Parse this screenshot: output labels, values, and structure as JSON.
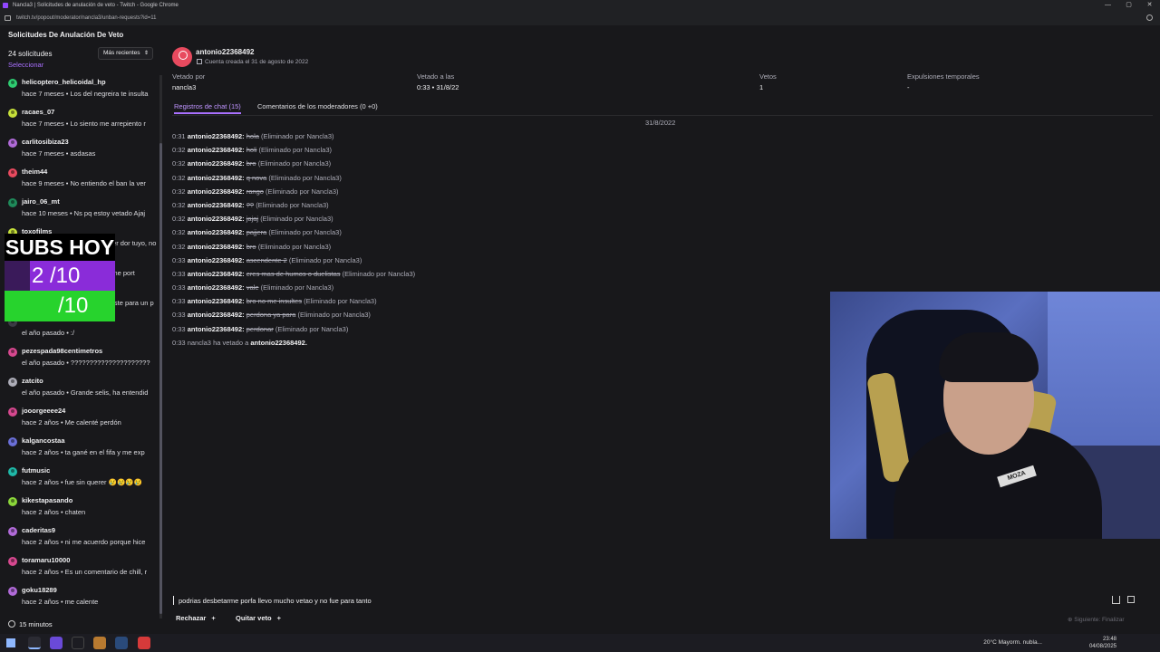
{
  "window": {
    "title": "Nancla3 | Solicitudes de anulación de veto - Twitch - Google Chrome",
    "url": "twitch.tv/popout/moderator/nancla3/unban-requests?id=11"
  },
  "sidebar": {
    "title": "Solicitudes De Anulación De Veto",
    "count": "24 solicitudes",
    "select_label": "Seleccionar",
    "sort_label": "Más recientes",
    "footer": "15 minutos",
    "items": [
      {
        "name": "helicoptero_helicoidal_hp",
        "meta": "hace 7 meses • Los del negreira te insulta",
        "color": "#2ecc71"
      },
      {
        "name": "racaes_07",
        "meta": "hace 7 meses • Lo siento me arrepiento r",
        "color": "#c6e03a"
      },
      {
        "name": "carlitosibiza23",
        "meta": "hace 7 meses • asdasas",
        "color": "#b06ad8"
      },
      {
        "name": "theim44",
        "meta": "hace 9 meses • No entiendo el ban la ver",
        "color": "#e84a5f"
      },
      {
        "name": "jairo_06_mt",
        "meta": "hace 10 meses • Ns pq estoy vetado Ajaj",
        "color": "#1f8a5a"
      },
      {
        "name": "toxofilms",
        "meta": "hace 11 meses • Perdón por ser dor tuyo, no",
        "color": "#c6e03a"
      },
      {
        "name": "",
        "meta": "el año pasado • Perdón, betarme port",
        "color": "#3b3b44"
      },
      {
        "name": "",
        "meta": "el año pasado • que me baneaste para un p",
        "color": "#3b3b44"
      },
      {
        "name": "",
        "meta": "el año pasado • :/",
        "color": "#3b3b44"
      },
      {
        "name": "pezespada98centimetros",
        "meta": "el año pasado • ?????????????????????",
        "color": "#d6488f"
      },
      {
        "name": "zatcito",
        "meta": "el año pasado • Grande selis, ha entendid",
        "color": "#adadb8"
      },
      {
        "name": "jooorgeeee24",
        "meta": "hace 2 años • Me calenté perdón",
        "color": "#d6488f"
      },
      {
        "name": "kalgancostaa",
        "meta": "hace 2 años • ta gané en el fifa y me exp",
        "color": "#6a6fd8"
      },
      {
        "name": "futmusic",
        "meta": "hace 2 años • fue sin querer 😢😢😢😢",
        "color": "#1fb8a8"
      },
      {
        "name": "kikestapasando",
        "meta": "hace 2 años • chaten",
        "color": "#8bd63a"
      },
      {
        "name": "caderitas9",
        "meta": "hace 2 años • ni me acuerdo porque hice",
        "color": "#b06ad8"
      },
      {
        "name": "toramaru10000",
        "meta": "hace 2 años • Es un comentario de chill, r",
        "color": "#d6488f"
      },
      {
        "name": "goku18289",
        "meta": "hace 2 años • me calente",
        "color": "#b06ad8"
      }
    ]
  },
  "overlay": {
    "title": "SUBS HOY",
    "row1": "2 /10",
    "row2": "/10"
  },
  "profile": {
    "username": "antonio22368492",
    "created": "Cuenta creada el 31 de agosto de 2022",
    "avatar_color": "#e84a5f"
  },
  "stats": {
    "banned_by_label": "Vetado por",
    "banned_by": "nancla3",
    "banned_at_label": "Vetado a las",
    "banned_at": "0:33 • 31/8/22",
    "bans_label": "Vetos",
    "bans": "1",
    "timeouts_label": "Expulsiones temporales",
    "timeouts": "-"
  },
  "tabs": {
    "chat_logs": "Registros de chat (15)",
    "mod_comments": "Comentarios de los moderadores (0 +0)"
  },
  "chat": {
    "date": "31/8/2022",
    "deleted_by": "(Eliminado por Nancla3)",
    "lines": [
      {
        "time": "0:31",
        "user": "antonio22368492:",
        "msg": "hola"
      },
      {
        "time": "0:32",
        "user": "antonio22368492:",
        "msg": "holi"
      },
      {
        "time": "0:32",
        "user": "antonio22368492:",
        "msg": "bro"
      },
      {
        "time": "0:32",
        "user": "antonio22368492:",
        "msg": "q nova"
      },
      {
        "time": "0:32",
        "user": "antonio22368492:",
        "msg": "rango"
      },
      {
        "time": "0:32",
        "user": "antonio22368492:",
        "msg": "??"
      },
      {
        "time": "0:32",
        "user": "antonio22368492:",
        "msg": "jajaj"
      },
      {
        "time": "0:32",
        "user": "antonio22368492:",
        "msg": "pajjera"
      },
      {
        "time": "0:32",
        "user": "antonio22368492:",
        "msg": "bro"
      },
      {
        "time": "0:33",
        "user": "antonio22368492:",
        "msg": "ascendente 2"
      },
      {
        "time": "0:33",
        "user": "antonio22368492:",
        "msg": "eres mas de humos o duelistas"
      },
      {
        "time": "0:33",
        "user": "antonio22368492:",
        "msg": "vale"
      },
      {
        "time": "0:33",
        "user": "antonio22368492:",
        "msg": "bro no me insultes"
      },
      {
        "time": "0:33",
        "user": "antonio22368492:",
        "msg": "perdona ya para"
      },
      {
        "time": "0:33",
        "user": "antonio22368492:",
        "msg": "perdonar"
      }
    ],
    "ban_line": {
      "time": "0:33",
      "actor": "nancla3",
      "text": "ha vetado a",
      "target": "antonio22368492."
    }
  },
  "reply": {
    "text": "podrias desbetarme porfa llevo mucho vetao y no fue para tanto"
  },
  "actions": {
    "deny": "Rechazar",
    "unban": "Quitar veto",
    "next": "Siguiente: Finalizar"
  },
  "webcam": {
    "logo": "MOZA"
  },
  "taskbar": {
    "weather": "20°C  Mayorm. nubla...",
    "time": "23:48",
    "date": "04/08/2025"
  }
}
